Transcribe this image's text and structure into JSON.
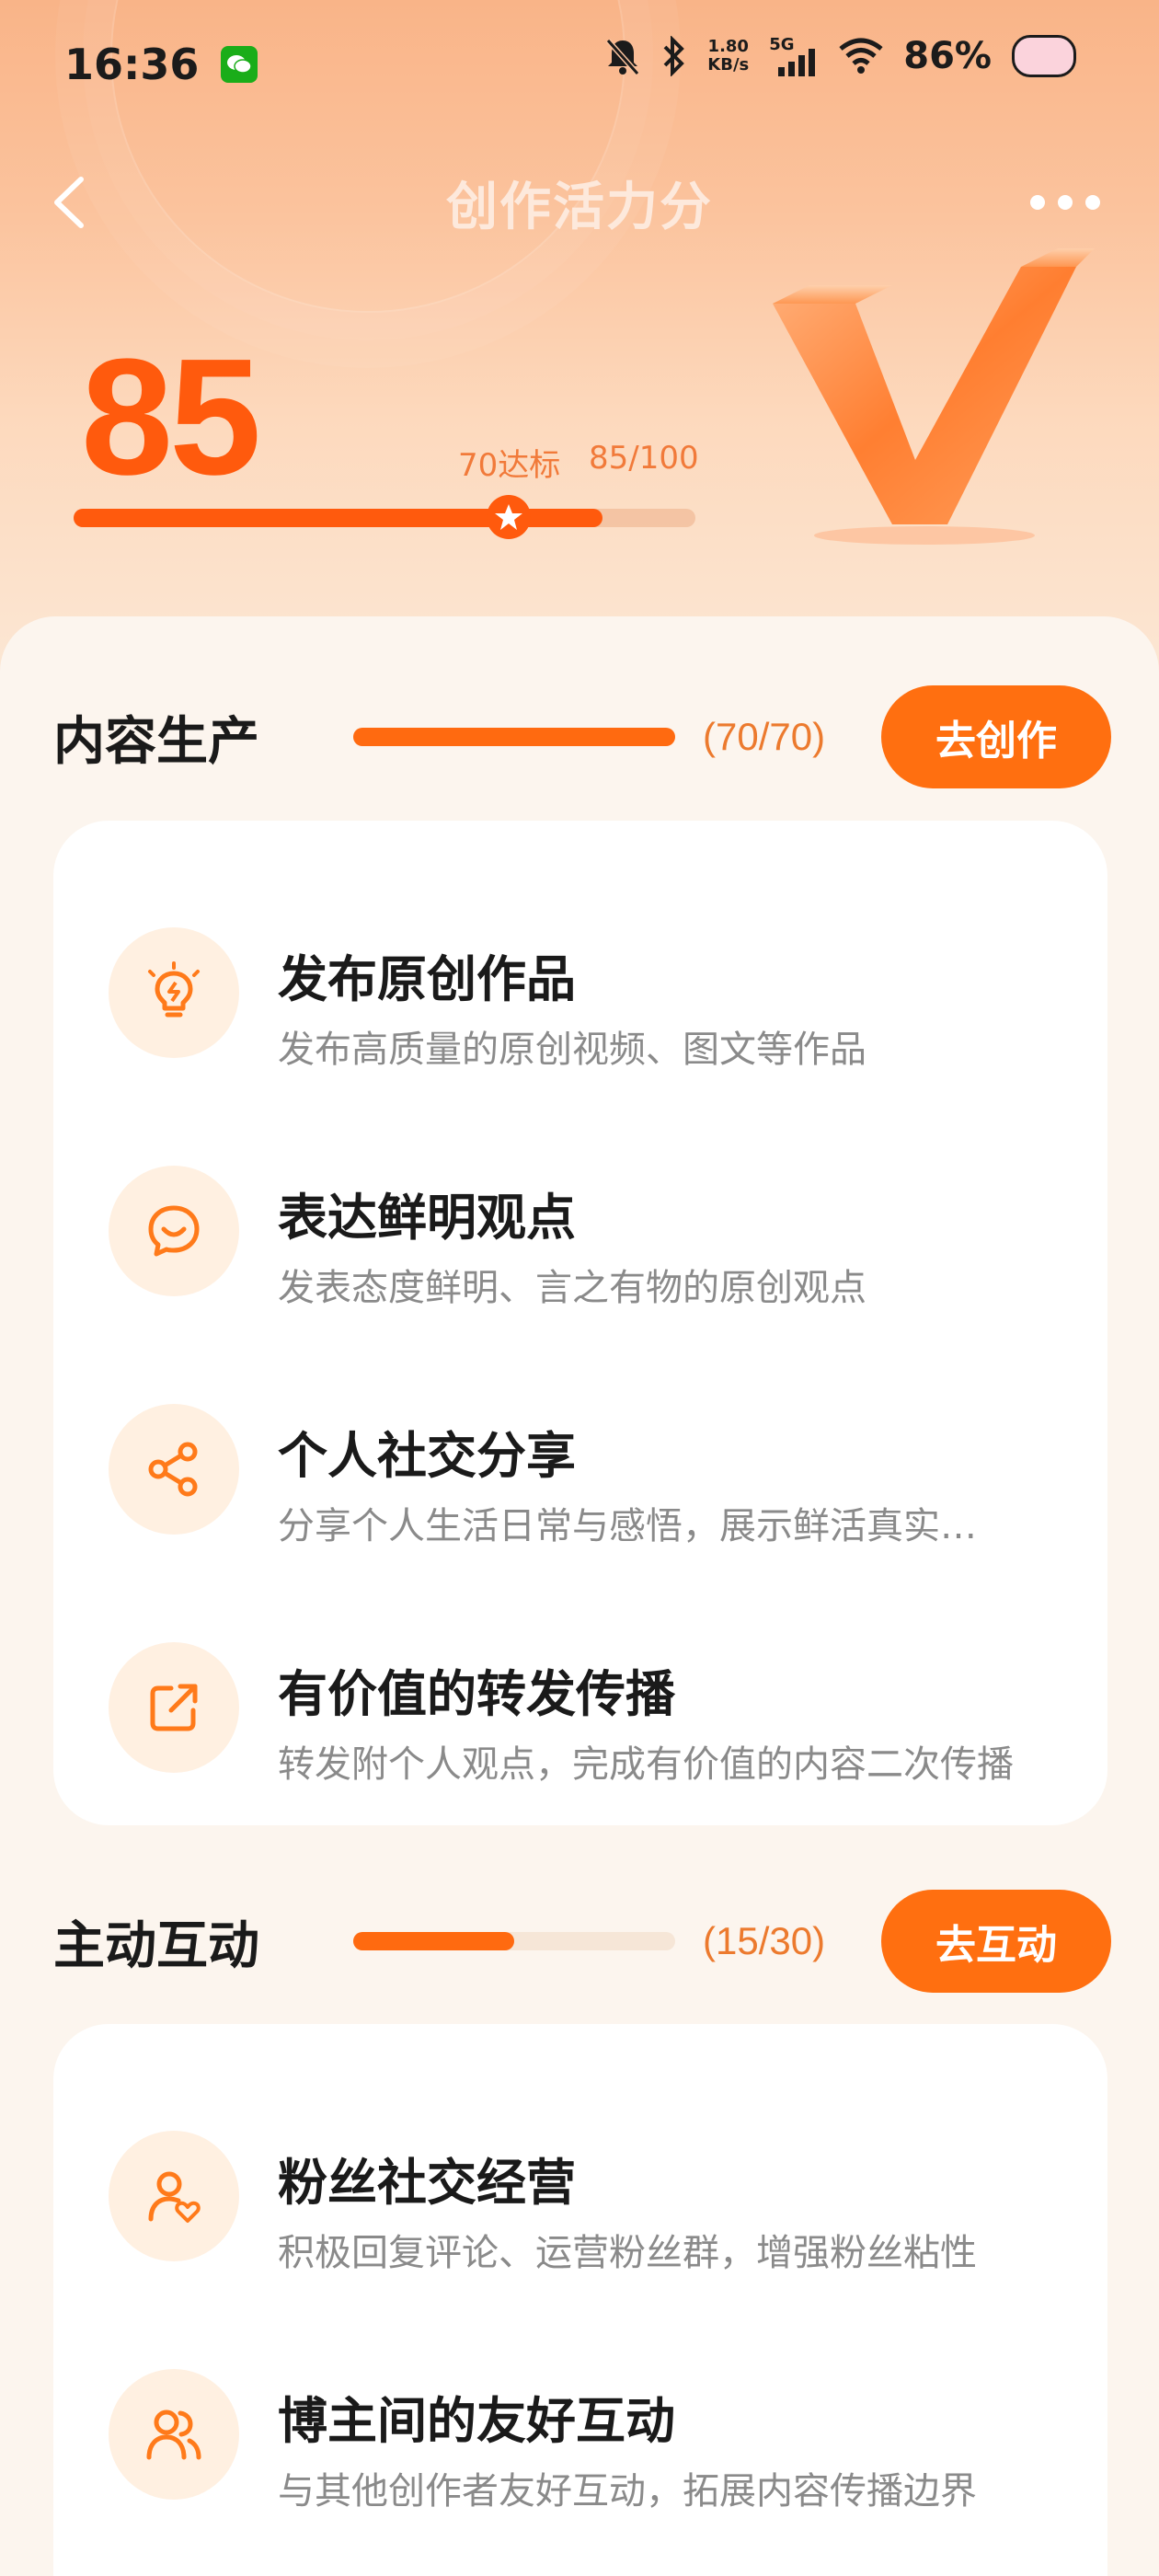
{
  "status_bar": {
    "time": "16:36",
    "net_speed_value": "1.80",
    "net_speed_unit": "KB/s",
    "network": "5G",
    "battery": "86%"
  },
  "nav": {
    "title": "创作活力分"
  },
  "score": {
    "value": "85",
    "target_label": "70达标",
    "fraction_label": "85/100",
    "progress": 0.85,
    "target_position": 0.7
  },
  "sections": [
    {
      "title": "内容生产",
      "count": "(70/70)",
      "progress": 1.0,
      "button": "去创作",
      "items": [
        {
          "icon": "lightbulb-icon",
          "title": "发布原创作品",
          "desc": "发布高质量的原创视频、图文等作品"
        },
        {
          "icon": "chat-smile-icon",
          "title": "表达鲜明观点",
          "desc": "发表态度鲜明、言之有物的原创观点"
        },
        {
          "icon": "share-icon",
          "title": "个人社交分享",
          "desc": "分享个人生活日常与感悟，展示鲜活真实…"
        },
        {
          "icon": "repost-icon",
          "title": "有价值的转发传播",
          "desc": "转发附个人观点，完成有价值的内容二次传播"
        }
      ]
    },
    {
      "title": "主动互动",
      "count": "(15/30)",
      "progress": 0.5,
      "button": "去互动",
      "items": [
        {
          "icon": "fan-heart-icon",
          "title": "粉丝社交经营",
          "desc": "积极回复评论、运营粉丝群，增强粉丝粘性"
        },
        {
          "icon": "users-icon",
          "title": "博主间的友好互动",
          "desc": "与其他创作者友好互动，拓展内容传播边界"
        }
      ]
    }
  ],
  "colors": {
    "accent": "#ff6f10",
    "score": "#ff5a0d",
    "icon_bg": "#fff0e1"
  }
}
